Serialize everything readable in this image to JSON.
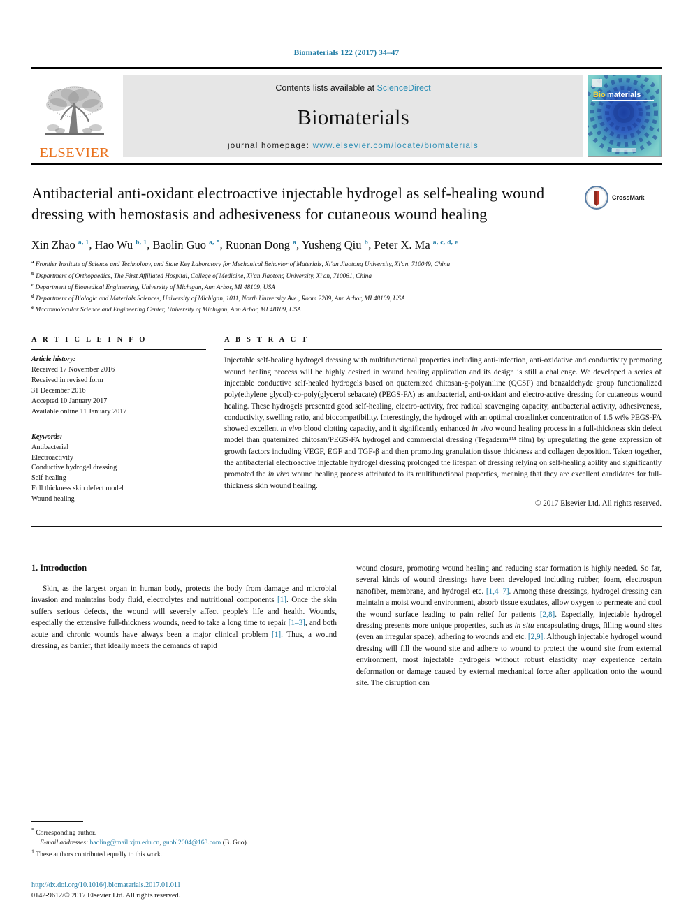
{
  "running_head": "Biomaterials 122 (2017) 34–47",
  "masthead": {
    "publisher_name": "ELSEVIER",
    "contents_prefix": "Contents lists available at ",
    "contents_link": "ScienceDirect",
    "journal_title": "Biomaterials",
    "homepage_prefix": "journal homepage: ",
    "homepage_url": "www.elsevier.com/locate/biomaterials",
    "cover_title_bio": "Bio",
    "cover_title_materials": "materials"
  },
  "article": {
    "title": "Antibacterial anti-oxidant electroactive injectable hydrogel as self-healing wound dressing with hemostasis and adhesiveness for cutaneous wound healing",
    "crossmark_label": "CrossMark",
    "authors": [
      {
        "name": "Xin Zhao",
        "marks": "a, 1"
      },
      {
        "name": "Hao Wu",
        "marks": "b, 1"
      },
      {
        "name": "Baolin Guo",
        "marks": "a, *"
      },
      {
        "name": "Ruonan Dong",
        "marks": "a"
      },
      {
        "name": "Yusheng Qiu",
        "marks": "b"
      },
      {
        "name": "Peter X. Ma",
        "marks": "a, c, d, e"
      }
    ],
    "affiliations": [
      {
        "mark": "a",
        "text": "Frontier Institute of Science and Technology, and State Key Laboratory for Mechanical Behavior of Materials, Xi'an Jiaotong University, Xi'an, 710049, China"
      },
      {
        "mark": "b",
        "text": "Department of Orthopaedics, The First Affiliated Hospital, College of Medicine, Xi'an Jiaotong University, Xi'an, 710061, China"
      },
      {
        "mark": "c",
        "text": "Department of Biomedical Engineering, University of Michigan, Ann Arbor, MI 48109, USA"
      },
      {
        "mark": "d",
        "text": "Department of Biologic and Materials Sciences, University of Michigan, 1011, North University Ave., Room 2209, Ann Arbor, MI 48109, USA"
      },
      {
        "mark": "e",
        "text": "Macromolecular Science and Engineering Center, University of Michigan, Ann Arbor, MI 48109, USA"
      }
    ]
  },
  "article_info": {
    "heading": "A R T I C L E   I N F O",
    "history_label": "Article history:",
    "history": [
      "Received 17 November 2016",
      "Received in revised form",
      "31 December 2016",
      "Accepted 10 January 2017",
      "Available online 11 January 2017"
    ],
    "keywords_label": "Keywords:",
    "keywords": [
      "Antibacterial",
      "Electroactivity",
      "Conductive hydrogel dressing",
      "Self-healing",
      "Full thickness skin defect model",
      "Wound healing"
    ]
  },
  "abstract": {
    "heading": "A B S T R A C T",
    "paragraph_part1": "Injectable self-healing hydrogel dressing with multifunctional properties including anti-infection, anti-oxidative and conductivity promoting wound healing process will be highly desired in wound healing application and its design is still a challenge. We developed a series of injectable conductive self-healed hydrogels based on quaternized chitosan-g-polyaniline (QCSP) and benzaldehyde group functionalized poly(ethylene glycol)-co-poly(glycerol sebacate) (PEGS-FA) as antibacterial, anti-oxidant and electro-active dressing for cutaneous wound healing. These hydrogels presented good self-healing, electro-activity, free radical scavenging capacity, antibacterial activity, adhesiveness, conductivity, swelling ratio, and biocompatibility. Interestingly, the hydrogel with an optimal crosslinker concentration of 1.5 wt% PEGS-FA showed excellent ",
    "italic1": "in vivo",
    "paragraph_part2": " blood clotting capacity, and it significantly enhanced ",
    "italic2": "in vivo",
    "paragraph_part3": " wound healing process in a full-thickness skin defect model than quaternized chitosan/PEGS-FA hydrogel and commercial dressing (Tegaderm™ film) by upregulating the gene expression of growth factors including VEGF, EGF and TGF-β and then promoting granulation tissue thickness and collagen deposition. Taken together, the antibacterial electroactive injectable hydrogel dressing prolonged the lifespan of dressing relying on self-healing ability and significantly promoted the ",
    "italic3": "in vivo",
    "paragraph_part4": " wound healing process attributed to its multifunctional properties, meaning that they are excellent candidates for full-thickness skin wound healing.",
    "copyright": "© 2017 Elsevier Ltd. All rights reserved."
  },
  "introduction": {
    "section_number_title": "1. Introduction",
    "left_part1": "Skin, as the largest organ in human body, protects the body from damage and microbial invasion and maintains body fluid, electrolytes and nutritional components ",
    "left_ref1": "[1]",
    "left_part2": ". Once the skin suffers serious defects, the wound will severely affect people's life and health. Wounds, especially the extensive full-thickness wounds, need to take a long time to repair ",
    "left_ref2": "[1–3]",
    "left_part3": ", and both acute and chronic wounds have always been a major clinical problem ",
    "left_ref3": "[1]",
    "left_part4": ". Thus, a wound dressing, as barrier, that ideally meets the demands of rapid",
    "right_part1": "wound closure, promoting wound healing and reducing scar formation is highly needed. So far, several kinds of wound dressings have been developed including rubber, foam, electrospun nanofiber, membrane, and hydrogel etc. ",
    "right_ref1": "[1,4–7]",
    "right_part2": ". Among these dressings, hydrogel dressing can maintain a moist wound environment, absorb tissue exudates, allow oxygen to permeate and cool the wound surface leading to pain relief for patients ",
    "right_ref2": "[2,8]",
    "right_part3": ". Especially, injectable hydrogel dressing presents more unique properties, such as ",
    "right_italic1": "in situ",
    "right_part4": " encapsulating drugs, filling wound sites (even an irregular space), adhering to wounds and etc. ",
    "right_ref3": "[2,9]",
    "right_part5": ". Although injectable hydrogel wound dressing will fill the wound site and adhere to wound to protect the wound site from external environment, most injectable hydrogels without robust elasticity may experience certain deformation or damage caused by external mechanical force after application onto the wound site. The disruption can"
  },
  "footnotes": {
    "corresponding_mark": "*",
    "corresponding_text": "Corresponding author.",
    "email_label": "E-mail addresses:",
    "email1": "baoling@mail.xjtu.edu.cn",
    "email_sep": ", ",
    "email2": "guobl2004@163.com",
    "email_suffix": " (B. Guo).",
    "equal_mark": "1",
    "equal_text": "These authors contributed equally to this work."
  },
  "footer": {
    "doi": "http://dx.doi.org/10.1016/j.biomaterials.2017.01.011",
    "issn_line": "0142-9612/© 2017 Elsevier Ltd. All rights reserved."
  },
  "colors": {
    "accent_blue": "#1f7ba4",
    "link_blue": "#2f8fb5",
    "elsevier_orange": "#E9711C",
    "masthead_grey": "#e6e6e6"
  }
}
